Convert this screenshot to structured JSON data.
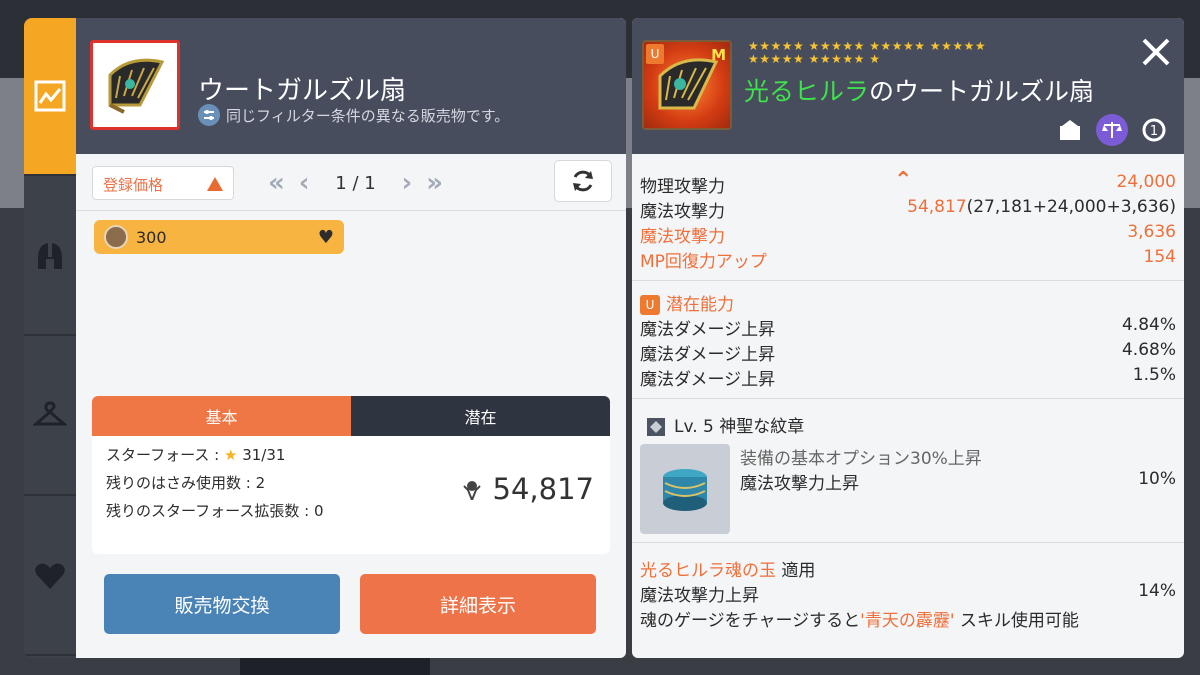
{
  "nav": {
    "items": [
      {
        "name": "chart-icon",
        "active": true
      },
      {
        "name": "helmet-icon",
        "active": false
      },
      {
        "name": "hanger-icon",
        "active": false
      },
      {
        "name": "heart-icon",
        "active": false
      }
    ]
  },
  "left": {
    "title": "ウートガルズル扇",
    "subtitle": "同じフィルター条件の異なる販売物です。",
    "sort_label": "登録価格",
    "page": "1 / 1",
    "listing_price": "300",
    "tabs": [
      "基本",
      "潜在"
    ],
    "starforce_label": "スターフォース :",
    "starforce_value": "31/31",
    "scissors": "残りのはさみ使用数 : 2",
    "starforce_ext": "残りのスターフォース拡張数 : 0",
    "power": "54,817",
    "btn_exchange": "販売物交換",
    "btn_detail": "詳細表示"
  },
  "right": {
    "stars_row1": "★★★★★ ★★★★★ ★★★★★ ★★★★★",
    "stars_row2": "★★★★★ ★★★★★ ★",
    "title_prefix": "光るヒルラ",
    "title_suffix": "のウートガルズル扇",
    "badge_u": "U",
    "badge_m": "M",
    "stats": [
      {
        "label": "物理攻撃力",
        "value": "24,000",
        "value_color": "orange"
      },
      {
        "label": "魔法攻撃力",
        "value_main": "54,817",
        "value_detail": "(27,181+24,000+3,636)"
      },
      {
        "label": "魔法攻撃力",
        "value": "3,636",
        "row_color": "orange"
      },
      {
        "label": "MP回復力アップ",
        "value": "154",
        "row_color": "orange"
      }
    ],
    "potential_title": "潜在能力",
    "potentials": [
      {
        "label": "魔法ダメージ上昇",
        "value": "4.84%"
      },
      {
        "label": "魔法ダメージ上昇",
        "value": "4.68%"
      },
      {
        "label": "魔法ダメージ上昇",
        "value": "1.5%"
      }
    ],
    "emblem_title": "Lv. 5 神聖な紋章",
    "emblem_line1": "装備の基本オプション30%上昇",
    "emblem_line2_label": "魔法攻撃力上昇",
    "emblem_line2_value": "10%",
    "soul_name": "光るヒルラ魂の玉",
    "soul_apply": "適用",
    "soul_stat_label": "魔法攻撃力上昇",
    "soul_stat_value": "14%",
    "soul_desc_pre": "魂のゲージをチャージすると",
    "soul_skill": "'青天の霹靂'",
    "soul_desc_post": "スキル使用可能"
  },
  "colors": {
    "orange": "#ef6f3a",
    "green": "#3ee24b",
    "header": "#474d5d",
    "nav_active": "#f5a623"
  }
}
